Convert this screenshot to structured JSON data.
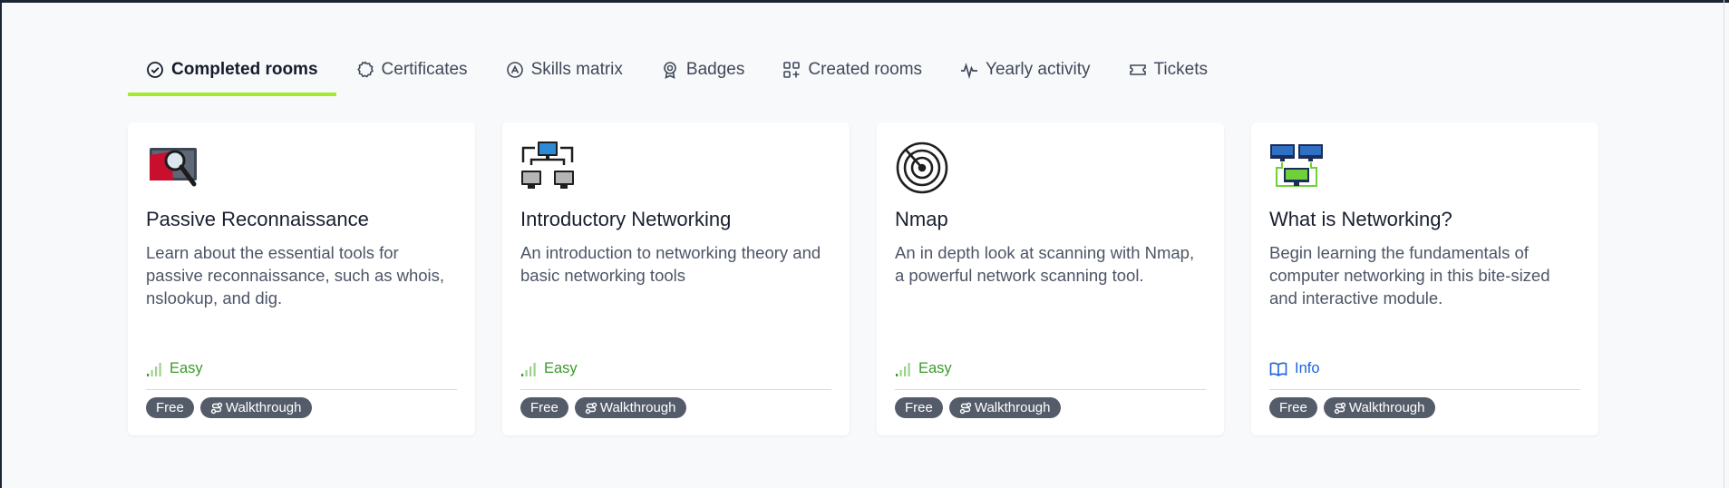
{
  "tabs": [
    {
      "label": "Completed rooms",
      "icon": "check-circle-icon",
      "active": true
    },
    {
      "label": "Certificates",
      "icon": "certificate-icon",
      "active": false
    },
    {
      "label": "Skills matrix",
      "icon": "skills-matrix-icon",
      "active": false
    },
    {
      "label": "Badges",
      "icon": "badge-icon",
      "active": false
    },
    {
      "label": "Created rooms",
      "icon": "grid-plus-icon",
      "active": false
    },
    {
      "label": "Yearly activity",
      "icon": "activity-pulse-icon",
      "active": false
    },
    {
      "label": "Tickets",
      "icon": "ticket-icon",
      "active": false
    }
  ],
  "cards": [
    {
      "title": "Passive Reconnaissance",
      "description": "Learn about the essential tools for passive reconnaissance, such as whois, nslookup, and dig.",
      "meta": "Easy",
      "meta_kind": "difficulty",
      "tags": [
        "Free",
        "Walkthrough"
      ],
      "icon": "magnifier-monitor-icon"
    },
    {
      "title": "Introductory Networking",
      "description": "An introduction to networking theory and basic networking tools",
      "meta": "Easy",
      "meta_kind": "difficulty",
      "tags": [
        "Free",
        "Walkthrough"
      ],
      "icon": "network-computers-icon"
    },
    {
      "title": "Nmap",
      "description": "An in depth look at scanning with Nmap, a powerful network scanning tool.",
      "meta": "Easy",
      "meta_kind": "difficulty",
      "tags": [
        "Free",
        "Walkthrough"
      ],
      "icon": "radar-icon"
    },
    {
      "title": "What is Networking?",
      "description": "Begin learning the fundamentals of computer networking in this bite-sized and interactive module.",
      "meta": "Info",
      "meta_kind": "info",
      "tags": [
        "Free",
        "Walkthrough"
      ],
      "icon": "connected-monitors-icon"
    }
  ],
  "colors": {
    "accent": "#a3ea2a",
    "difficulty_easy": "#3b9a2c",
    "info": "#1b64d8",
    "tag_bg": "#545c6a"
  }
}
